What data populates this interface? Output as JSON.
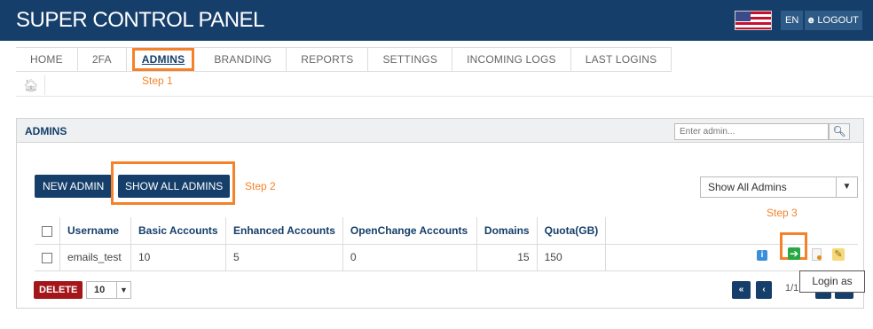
{
  "header": {
    "title": "SUPER CONTROL PANEL",
    "lang": "EN",
    "logout": "LOGOUT",
    "colors": {
      "bar": "#153e6a",
      "accent": "#f5822a"
    }
  },
  "nav": {
    "items": [
      {
        "label": "HOME"
      },
      {
        "label": "2FA"
      },
      {
        "label": "ADMINS"
      },
      {
        "label": "BRANDING"
      },
      {
        "label": "REPORTS"
      },
      {
        "label": "SETTINGS"
      },
      {
        "label": "INCOMING LOGS"
      },
      {
        "label": "LAST LOGINS"
      }
    ],
    "active": "ADMINS"
  },
  "annotations": {
    "step1": "Step 1",
    "step2": "Step 2",
    "step3": "Step 3"
  },
  "panel": {
    "title": "ADMINS",
    "search_placeholder": "Enter admin...",
    "new_admin": "NEW ADMIN",
    "show_all": "SHOW ALL ADMINS",
    "filter_selected": "Show All Admins"
  },
  "table": {
    "columns": [
      "Username",
      "Basic Accounts",
      "Enhanced Accounts",
      "OpenChange Accounts",
      "Domains",
      "Quota(GB)"
    ],
    "rows": [
      {
        "username": "emails_test",
        "basic": "10",
        "enhanced": "5",
        "openchange": "0",
        "domains": "15",
        "quota": "150"
      }
    ]
  },
  "footer": {
    "delete": "DELETE",
    "per_page": "10",
    "page": "1/1",
    "tooltip": "Login as"
  },
  "icons": [
    "home-icon",
    "lock-icon",
    "search-icon",
    "info-icon",
    "login-as-icon",
    "document-icon",
    "edit-icon"
  ]
}
